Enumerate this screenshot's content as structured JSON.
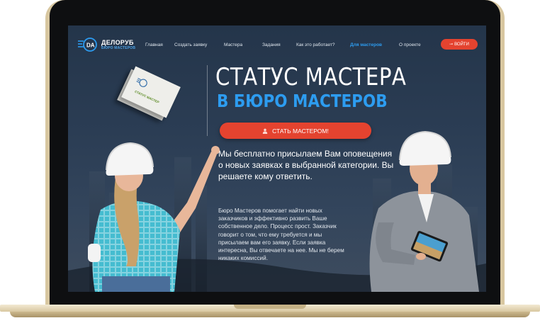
{
  "brand": {
    "name": "ДЕЛОРУБ",
    "subtitle": "БЮРО МАСТЕРОВ",
    "accent": "#2d9cf0",
    "cta_color": "#e4432f"
  },
  "nav": {
    "items": [
      {
        "label": "Главная",
        "active": false
      },
      {
        "label": "Создать заявку",
        "active": false
      },
      {
        "label": "Мастера",
        "active": false
      },
      {
        "label": "Задания",
        "active": false
      },
      {
        "label": "Как это работает?",
        "active": false
      },
      {
        "label": "Для мастеров",
        "active": true
      },
      {
        "label": "О проекте",
        "active": false
      }
    ],
    "login_label": "ВОЙТИ",
    "login_icon": "key-icon"
  },
  "hero": {
    "headline": "СТАТУС МАСТЕРА",
    "subheadline": "В БЮРО МАСТЕРОВ",
    "cta_label": "СТАТЬ МАСТЕРОМ!",
    "cta_icon": "user-icon",
    "lead": "Мы бесплатно присылаем Вам оповещения о новых заявках в выбранной категории. Вы решаете кому ответить.",
    "body": "Бюро Мастеров помогает найти новых заказчиков и эффективно развить Ваше собственное дело. Процесс прост. Заказчик говорит о том, что ему требуется и мы присылаем вам его заявку. Если заявка интересна, Вы отвечаете на нее. Мы не берем никаких комиссий."
  },
  "business_card": {
    "text": "СТАТУС МАСТЕР"
  }
}
